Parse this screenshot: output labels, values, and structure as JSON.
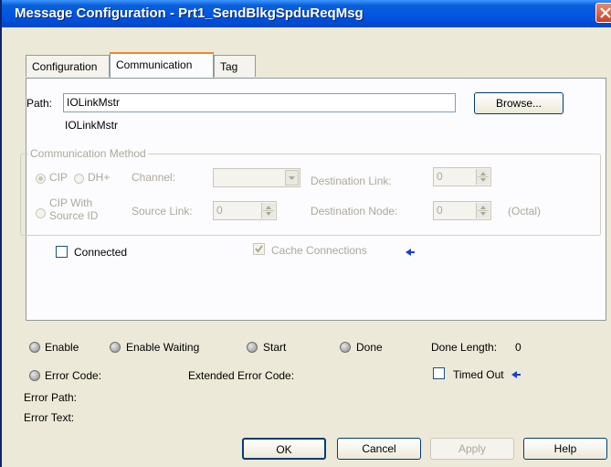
{
  "window": {
    "title": "Message Configuration - Prt1_SendBlkgSpduReqMsg"
  },
  "tabs": [
    {
      "label": "Configuration"
    },
    {
      "label": "Communication"
    },
    {
      "label": "Tag"
    }
  ],
  "path": {
    "label": "Path:",
    "value": "IOLinkMstr",
    "resolved": "IOLinkMstr",
    "browse_label": "Browse..."
  },
  "comm_method": {
    "group_label": "Communication Method",
    "cip_label": "CIP",
    "dh_label": "DH+",
    "channel_label": "Channel:",
    "channel_value": "",
    "dest_link_label": "Destination Link:",
    "dest_link_value": "0",
    "cip_source_label_1": "CIP With",
    "cip_source_label_2": "Source ID",
    "source_link_label": "Source Link:",
    "source_link_value": "0",
    "dest_node_label": "Destination Node:",
    "dest_node_value": "0",
    "octal_label": "(Octal)"
  },
  "connected_label": "Connected",
  "cache_label": "Cache Connections",
  "status": {
    "enable": "Enable",
    "enable_waiting": "Enable Waiting",
    "start": "Start",
    "done": "Done",
    "done_length_label": "Done Length:",
    "done_length_value": "0",
    "error_code": "Error Code:",
    "extended_error_code": "Extended Error Code:",
    "timed_out": "Timed Out",
    "error_path": "Error Path:",
    "error_text": "Error Text:"
  },
  "buttons": {
    "ok": "OK",
    "cancel": "Cancel",
    "apply": "Apply",
    "help": "Help"
  },
  "colors": {
    "title_bar": "#0054e3",
    "dialog_bg": "#ece9d8",
    "accent_tab": "#e68b2c",
    "pointer_arrow": "#1a3fd6"
  }
}
